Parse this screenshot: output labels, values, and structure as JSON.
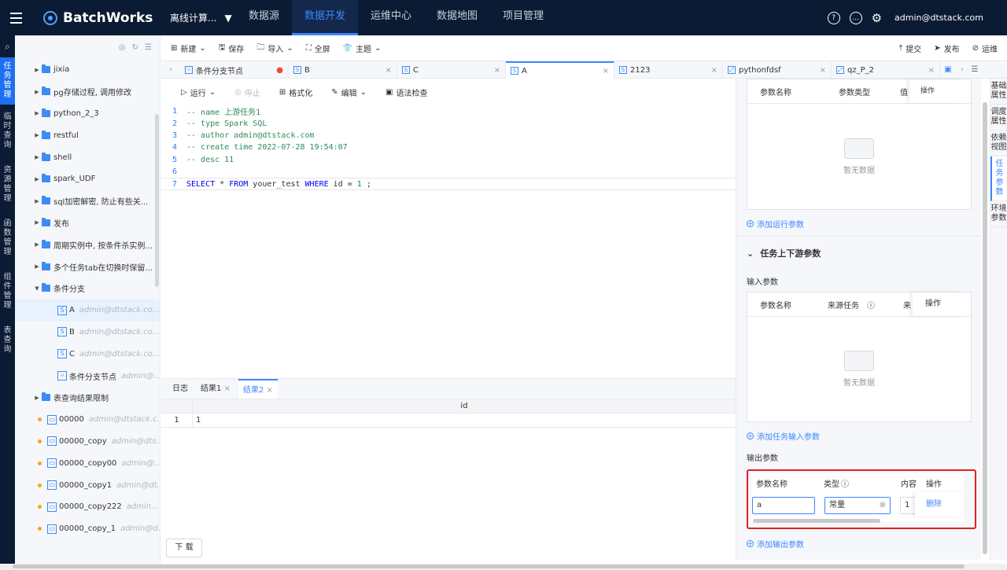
{
  "app": {
    "title": "BatchWorks",
    "project": "离线计算..."
  },
  "nav": [
    "数据源",
    "数据开发",
    "运维中心",
    "数据地图",
    "项目管理"
  ],
  "user": "admin@dtstack.com",
  "left_rail": [
    "任务管理",
    "临时查询",
    "资源管理",
    "函数管理",
    "组件管理",
    "表查询"
  ],
  "tree": [
    {
      "label": "jixia"
    },
    {
      "label": "pg存储过程, 调用修改"
    },
    {
      "label": "python_2_3"
    },
    {
      "label": "restful"
    },
    {
      "label": "shell"
    },
    {
      "label": "spark_UDF"
    },
    {
      "label": "sql加密解密, 防止有些关..."
    },
    {
      "label": "发布"
    },
    {
      "label": "周期实例中, 按条件杀实例..."
    },
    {
      "label": "多个任务tab在切换时保留..."
    },
    {
      "label": "条件分支"
    },
    {
      "label": "A",
      "meta": "admin@dtstack.co..."
    },
    {
      "label": "B",
      "meta": "admin@dtstack.co..."
    },
    {
      "label": "C",
      "meta": "admin@dtstack.co..."
    },
    {
      "label": "条件分支节点",
      "meta": "admin@..."
    },
    {
      "label": "表查询结果限制"
    },
    {
      "label": "00000",
      "meta": "admin@dtstack.c..."
    },
    {
      "label": "00000_copy",
      "meta": "admin@dts..."
    },
    {
      "label": "00000_copy00",
      "meta": "admin@..."
    },
    {
      "label": "00000_copy1",
      "meta": "admin@dt..."
    },
    {
      "label": "00000_copy222",
      "meta": "admin..."
    },
    {
      "label": "00000_copy_1",
      "meta": "admin@d..."
    }
  ],
  "toolbar": {
    "new": "新建",
    "save": "保存",
    "import": "导入",
    "fullscreen": "全屏",
    "theme": "主题",
    "submit": "提交",
    "publish": "发布",
    "ops": "运维"
  },
  "tabs": [
    {
      "label": "条件分支节点"
    },
    {
      "label": "B"
    },
    {
      "label": "C"
    },
    {
      "label": "A"
    },
    {
      "label": "2123"
    },
    {
      "label": "pythonfdsf"
    },
    {
      "label": "qz_P_2"
    }
  ],
  "editor_tools": {
    "run": "运行",
    "stop": "停止",
    "format": "格式化",
    "edit": "编辑",
    "syntax": "语法检查"
  },
  "code": [
    {
      "n": "1",
      "text": "-- name 上游任务1"
    },
    {
      "n": "2",
      "text": "-- type Spark SQL"
    },
    {
      "n": "3",
      "text": "-- author admin@dtstack.com"
    },
    {
      "n": "4",
      "text": "-- create time 2022-07-28 19:54:07"
    },
    {
      "n": "5",
      "text": "-- desc 11"
    },
    {
      "n": "6",
      "text": ""
    },
    {
      "n": "7",
      "kw1": "SELECT",
      "star": " * ",
      "kw2": "FROM",
      "tbl": " youer_test ",
      "kw3": "WHERE",
      "cond": " id = ",
      "num": "1",
      "end": " ;"
    }
  ],
  "result": {
    "tabs": [
      "日志",
      "结果1",
      "结果2"
    ],
    "column": "id",
    "rows": [
      {
        "idx": "1",
        "value": "1"
      }
    ],
    "download": "下 载"
  },
  "panel": {
    "run_params": {
      "cols": [
        "参数名称",
        "参数类型",
        "值",
        "操作"
      ],
      "empty": "暂无数据",
      "add": "添加运行参数"
    },
    "ctx_title": "任务上下游参数",
    "input": {
      "label": "输入参数",
      "cols": [
        "参数名称",
        "来源任务",
        "来",
        "操作"
      ],
      "empty": "暂无数据",
      "add": "添加任务输入参数"
    },
    "output": {
      "label": "输出参数",
      "cols": [
        "参数名称",
        "类型",
        "内容",
        "操作"
      ],
      "name_value": "a",
      "type_value": "常量",
      "content_value": "1",
      "delete": "删除",
      "add": "添加输出参数"
    }
  },
  "side_tabs": [
    "基础属性",
    "调度属性",
    "依赖视图",
    "任务参数",
    "环境参数"
  ]
}
